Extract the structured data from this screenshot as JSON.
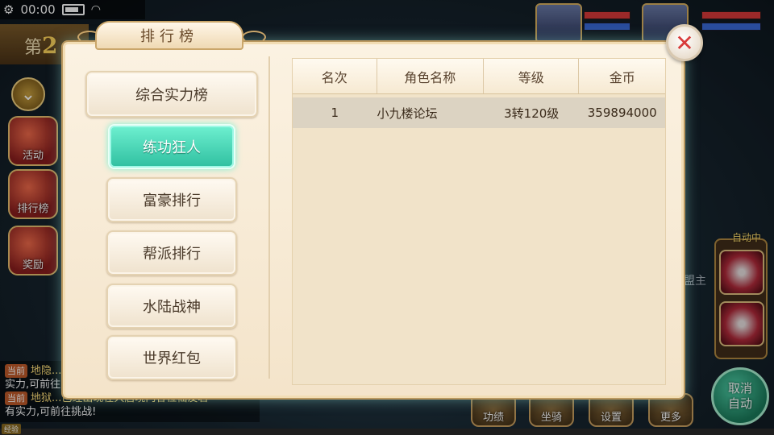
{
  "status_bar": {
    "time": "00:00"
  },
  "stage": {
    "prefix": "第",
    "number": "2"
  },
  "left_menu": [
    {
      "label": "活动"
    },
    {
      "label": "排行榜"
    },
    {
      "label": "奖励"
    }
  ],
  "right_panel": {
    "auto_label": "自动中",
    "cancel_auto": "取消\n自动"
  },
  "bottom_menu": [
    {
      "label": "功绩"
    },
    {
      "label": "坐骑"
    },
    {
      "label": "设置"
    },
    {
      "label": "更多"
    }
  ],
  "npc_text": "武林盟主",
  "chat": [
    {
      "tag": "当前",
      "text": "地隐...",
      "cont": "实力,可前往..."
    },
    {
      "tag": "当前",
      "text": "地狱...已经出现在大唐境内各位仙友若",
      "cont": "有实力,可前往挑战!"
    }
  ],
  "xp_label": "经验",
  "modal": {
    "title": "排行榜",
    "close_symbol": "✕",
    "categories": [
      {
        "label": "综合实力榜",
        "active": false
      },
      {
        "label": "练功狂人",
        "active": true
      },
      {
        "label": "富豪排行",
        "active": false
      },
      {
        "label": "帮派排行",
        "active": false
      },
      {
        "label": "水陆战神",
        "active": false
      },
      {
        "label": "世界红包",
        "active": false
      }
    ],
    "table": {
      "headers": [
        "名次",
        "角色名称",
        "等级",
        "金币"
      ],
      "rows": [
        [
          "1",
          "小九楼论坛",
          "3转120级",
          "359894000"
        ]
      ]
    }
  },
  "colors": {
    "active_tab": "#2fbfa0",
    "close_x": "#d83a3a",
    "panel_bg": "#f1e3c9"
  }
}
